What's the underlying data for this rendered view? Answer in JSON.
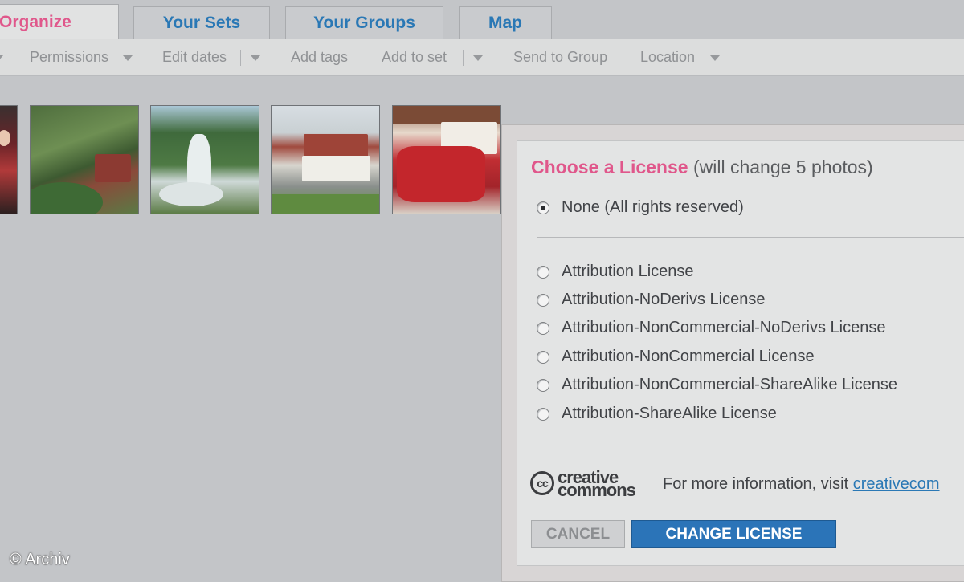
{
  "tabs": [
    {
      "label": "Organize",
      "active": true
    },
    {
      "label": "Your Sets",
      "active": false
    },
    {
      "label": "Your Groups",
      "active": false
    },
    {
      "label": "Map",
      "active": false
    }
  ],
  "toolbar": {
    "permissions": "Permissions",
    "edit_dates": "Edit dates",
    "add_tags": "Add tags",
    "add_to_set": "Add to set",
    "send_to_group": "Send to Group",
    "location": "Location"
  },
  "thumbnails_count": 5,
  "dialog": {
    "title": "Choose a License",
    "subtitle": "(will change 5 photos)",
    "none_option": "None (All rights reserved)",
    "options": [
      "Attribution License",
      "Attribution-NoDerivs License",
      "Attribution-NonCommercial-NoDerivs License",
      "Attribution-NonCommercial License",
      "Attribution-NonCommercial-ShareAlike License",
      "Attribution-ShareAlike License"
    ],
    "selected": "None (All rights reserved)",
    "info_text": "For more information, visit",
    "info_link": "creativecom",
    "cancel": "CANCEL",
    "change": "CHANGE LICENSE"
  },
  "logo": {
    "cc": "cc",
    "word1": "creative",
    "word2": "commons"
  },
  "watermark": "© Archiv",
  "colors": {
    "accent_pink": "#e0578b",
    "link_blue": "#2a78b5",
    "button_blue": "#2b74b8"
  }
}
